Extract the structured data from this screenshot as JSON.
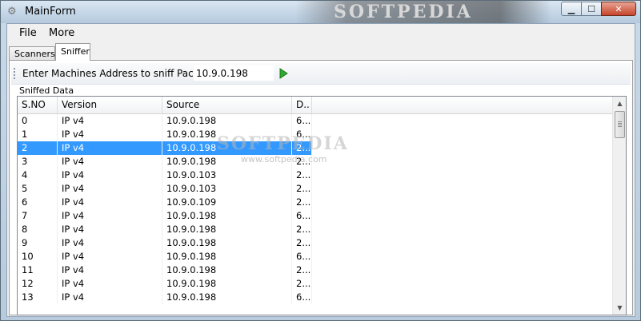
{
  "window": {
    "title": "MainForm",
    "watermark": "SOFTPEDIA",
    "controls": {
      "minimize": "▁",
      "maximize": "☐",
      "close": "✕"
    }
  },
  "menu": {
    "file": "File",
    "more": "More"
  },
  "tabs": [
    {
      "label": "Scanners"
    },
    {
      "label": "Sniffer"
    }
  ],
  "sniffer": {
    "address_label": "Enter Machines Address to sniff Packets",
    "address_value": "10.9.0.198",
    "group_label": "Sniffed Data"
  },
  "table": {
    "columns": [
      "S.NO",
      "Version",
      "Source",
      "D.."
    ],
    "rows": [
      [
        "0",
        "IP v4",
        "10.9.0.198",
        "6..."
      ],
      [
        "1",
        "IP v4",
        "10.9.0.198",
        "6..."
      ],
      [
        "2",
        "IP v4",
        "10.9.0.198",
        "2..."
      ],
      [
        "3",
        "IP v4",
        "10.9.0.198",
        "2..."
      ],
      [
        "4",
        "IP v4",
        "10.9.0.103",
        "2..."
      ],
      [
        "5",
        "IP v4",
        "10.9.0.103",
        "2..."
      ],
      [
        "6",
        "IP v4",
        "10.9.0.109",
        "2..."
      ],
      [
        "7",
        "IP v4",
        "10.9.0.198",
        "6..."
      ],
      [
        "8",
        "IP v4",
        "10.9.0.198",
        "2..."
      ],
      [
        "9",
        "IP v4",
        "10.9.0.198",
        "2..."
      ],
      [
        "10",
        "IP v4",
        "10.9.0.198",
        "6..."
      ],
      [
        "11",
        "IP v4",
        "10.9.0.198",
        "2..."
      ],
      [
        "12",
        "IP v4",
        "10.9.0.198",
        "2..."
      ],
      [
        "13",
        "IP v4",
        "10.9.0.198",
        "6..."
      ]
    ],
    "selected_index": 2
  },
  "scrollbar": {
    "up_arrow": "▲",
    "down_arrow": "▼"
  },
  "overlay_watermark": {
    "brand": "SOFTPEDIA",
    "url": "www.softpedia.com"
  },
  "colors": {
    "selection": "#3399ff",
    "play": "#2ea82e"
  }
}
